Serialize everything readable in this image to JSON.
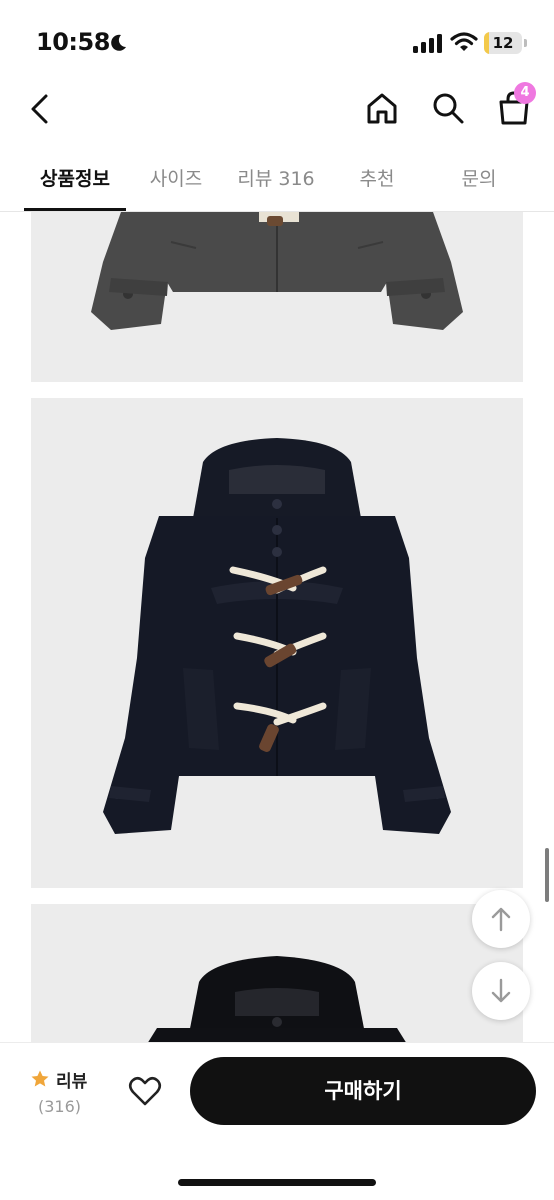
{
  "status_bar": {
    "time": "10:58",
    "battery": "12",
    "battery_level": 0.12,
    "moon_icon": "moon-icon",
    "signal_icon": "cellular-signal-icon",
    "wifi_icon": "wifi-icon"
  },
  "header": {
    "back_icon": "chevron-left-icon",
    "home_icon": "home-icon",
    "search_icon": "search-icon",
    "cart_icon": "shopping-bag-icon",
    "cart_count": "4",
    "badge_color": "#ef78e0"
  },
  "tabs": [
    {
      "label": "상품정보",
      "active": true
    },
    {
      "label": "사이즈",
      "active": false
    },
    {
      "label": "리뷰 316",
      "active": false
    },
    {
      "label": "추천",
      "active": false
    },
    {
      "label": "문의",
      "active": false
    }
  ],
  "floating": {
    "up_icon": "arrow-up-icon",
    "down_icon": "arrow-down-icon"
  },
  "bottom_bar": {
    "star_icon": "star-icon",
    "star_color": "#f0a63a",
    "review_label": "리뷰",
    "review_count": "(316)",
    "like_icon": "heart-icon",
    "buy_label": "구매하기"
  }
}
